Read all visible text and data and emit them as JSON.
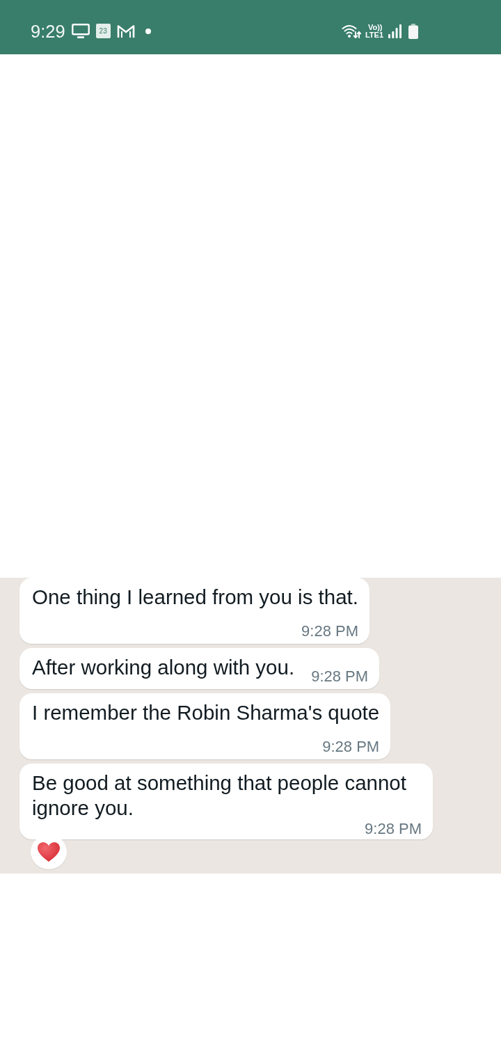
{
  "status_bar": {
    "time": "9:29",
    "calendar_day": "23",
    "volte_label": "Vo))",
    "network_label": "LTE1"
  },
  "messages": [
    {
      "text": "One thing I learned from you is that.",
      "time": "9:28 PM",
      "reacted": false
    },
    {
      "text": "After working along with you.",
      "time": "9:28 PM",
      "reacted": false
    },
    {
      "text": "I remember the Robin Sharma's quote",
      "time": "9:28 PM",
      "reacted": false
    },
    {
      "text": "Be good at something that people cannot ignore you.",
      "time": "9:28 PM",
      "reacted": true
    }
  ]
}
